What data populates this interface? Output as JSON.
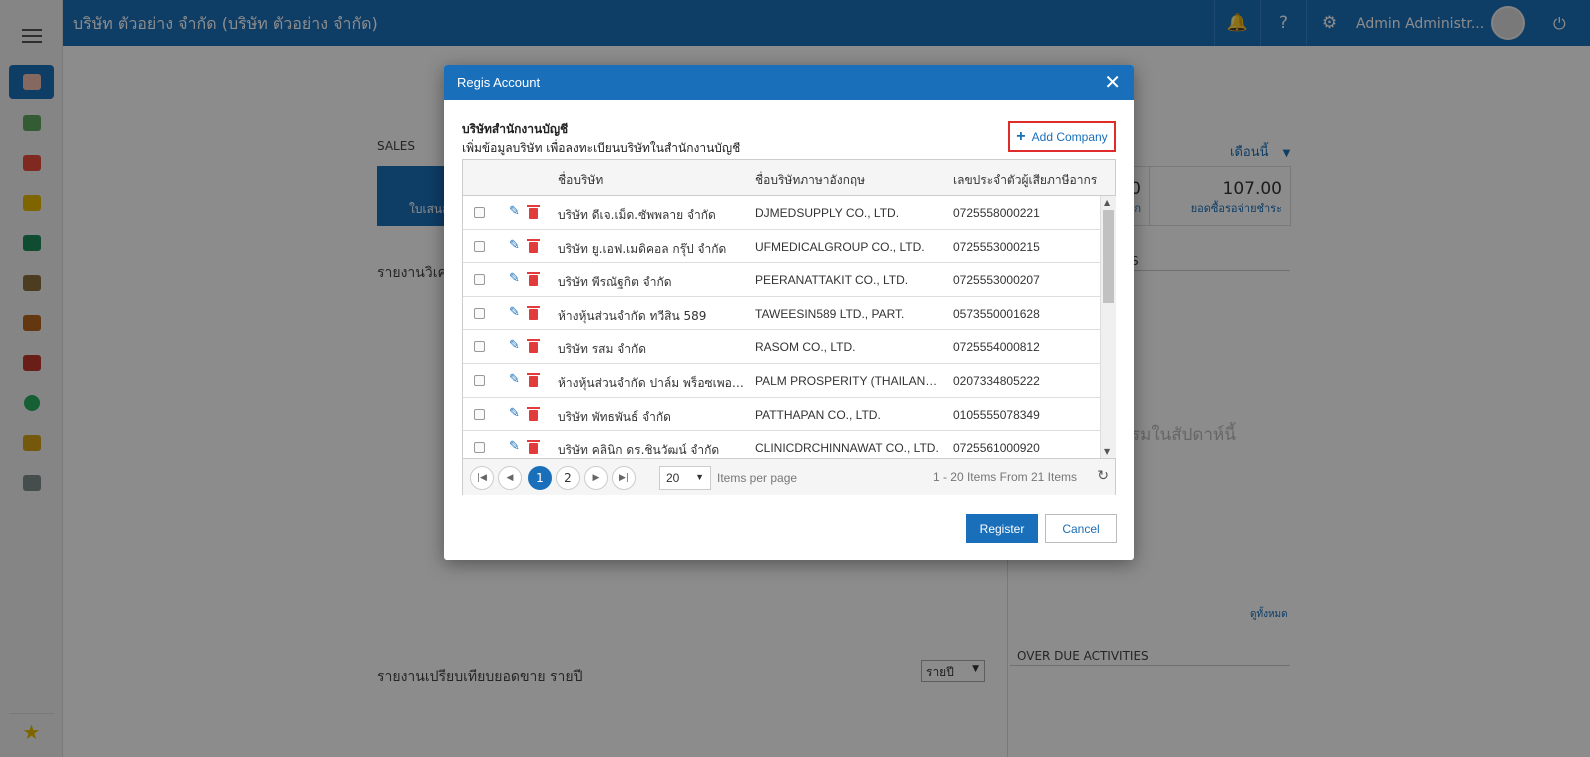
{
  "app": {
    "title": "บริษัท ตัวอย่าง จำกัด (บริษัท ตัวอย่าง จำกัด)",
    "user_name": "Admin Administr...",
    "brand_color": "#1a6fba"
  },
  "sidebar": {
    "items": [
      {
        "icon": "monitor-icon",
        "active": true
      },
      {
        "icon": "money-icon"
      },
      {
        "icon": "cart-icon"
      },
      {
        "icon": "box-icon"
      },
      {
        "icon": "book-icon"
      },
      {
        "icon": "bank-icon"
      },
      {
        "icon": "wallet-icon"
      },
      {
        "icon": "contact-icon"
      },
      {
        "icon": "check-icon"
      },
      {
        "icon": "report-icon"
      },
      {
        "icon": "tools-icon"
      }
    ],
    "favorite_icon": "star-icon"
  },
  "dashboard": {
    "sales_label": "SALES",
    "sales_card_text": "ใบเสนอ",
    "report_title": "รายงานวิเค",
    "stat_value": "107.00",
    "stat_label": "ยอดซื้อรอจ่ายชำระ",
    "stat_left_value": "0",
    "stat_left_label": "ก",
    "month_filter": "เดือนนี้",
    "activities_suffix": "S",
    "no_activity_text": "รมในสัปดาห์นี้",
    "view_all": "ดูทั้งหมด",
    "overdue_title": "OVER DUE ACTIVITIES",
    "yearly_report_title": "รายงานเปรียบเทียบยอดขาย รายปี",
    "year_select": "รายปี"
  },
  "modal": {
    "title": "Regis Account",
    "heading": "บริษัทสำนักงานบัญชี",
    "subheading": "เพิ่มข้อมูลบริษัท เพื่อลงทะเบียนบริษัทในสำนักงานบัญชี",
    "add_company_label": "Add Company",
    "columns": [
      "ชื่อบริษัท",
      "ชื่อบริษัทภาษาอังกฤษ",
      "เลขประจำตัวผู้เสียภาษีอากร"
    ],
    "rows": [
      {
        "name_th": "บริษัท ดีเจ.เม็ด.ซัพพลาย จำกัด",
        "name_en": "DJMEDSUPPLY CO., LTD.",
        "tax_id": "0725558000221"
      },
      {
        "name_th": "บริษัท ยู.เอฟ.เมดิคอล กรุ๊ป จำกัด",
        "name_en": "UFMEDICALGROUP CO., LTD.",
        "tax_id": "0725553000215"
      },
      {
        "name_th": "บริษัท พีรณัฐกิต จำกัด",
        "name_en": "PEERANATTAKIT CO., LTD.",
        "tax_id": "0725553000207"
      },
      {
        "name_th": "ห้างหุ้นส่วนจำกัด ทวีสิน 589",
        "name_en": "TAWEESIN589 LTD., PART.",
        "tax_id": "0573550001628"
      },
      {
        "name_th": "บริษัท รสม จำกัด",
        "name_en": "RASOM CO., LTD.",
        "tax_id": "0725554000812"
      },
      {
        "name_th": "ห้างหุ้นส่วนจำกัด ปาล์ม พร็อซเพอริตี้...",
        "name_en": "PALM PROSPERITY (THAILAND) L...",
        "tax_id": "0207334805222"
      },
      {
        "name_th": "บริษัท พัทธพันธ์ จำกัด",
        "name_en": "PATTHAPAN CO., LTD.",
        "tax_id": "0105555078349"
      },
      {
        "name_th": "บริษัท คลินิก ดร.ชินวัฒน์ จำกัด",
        "name_en": "CLINICDRCHINNAWAT CO., LTD.",
        "tax_id": "0725561000920"
      }
    ],
    "pager": {
      "pages": [
        "1",
        "2"
      ],
      "current_page": "1",
      "per_page": "20",
      "items_per_page_label": "Items per page",
      "range_text": "1 - 20 Items From 21 Items"
    },
    "register_label": "Register",
    "cancel_label": "Cancel"
  }
}
